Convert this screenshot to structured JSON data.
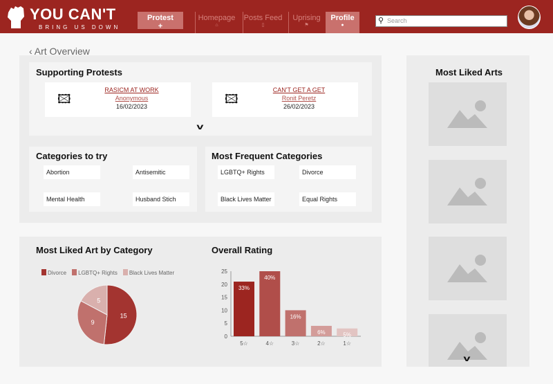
{
  "header": {
    "logo_title": "YOU CAN'T",
    "logo_subtitle": "BRING US DOWN",
    "protest_label": "Protest",
    "protest_icon": "+",
    "nav": [
      {
        "label": "Homepage",
        "icon": "home-icon"
      },
      {
        "label": "Posts Feed",
        "icon": "document-icon"
      },
      {
        "label": "Uprising",
        "icon": "flag-icon"
      },
      {
        "label": "Profile",
        "icon": "user-icon",
        "active": true
      }
    ],
    "search_placeholder": "Search"
  },
  "page": {
    "back_label": "Art Overview"
  },
  "supporting": {
    "title": "Supporting Protests",
    "items": [
      {
        "title": "RASICM AT WORK",
        "author": "Anonymous",
        "date": "16/02/2023"
      },
      {
        "title": "CAN'T GET A GET",
        "author": "Ronit Peretz",
        "date": "26/02/2023"
      }
    ]
  },
  "categories_try": {
    "title": "Categories to try",
    "items": [
      "Abortion",
      "Antisemitic",
      "Mental Health",
      "Husband Stich"
    ]
  },
  "frequent": {
    "title": "Most Frequent Categories",
    "items": [
      "LGBTQ+ Rights",
      "Divorce",
      "Black Lives Matter",
      "Equal Rights"
    ]
  },
  "most_liked_arts": {
    "title": "Most Liked Arts"
  },
  "chart_data": [
    {
      "type": "pie",
      "title": "Most Liked Art by Category",
      "categories": [
        "Divorce",
        "LGBTQ+ Rights",
        "Black Lives Matter"
      ],
      "values": [
        15,
        9,
        5
      ],
      "colors": [
        "#a33430",
        "#c0716d",
        "#d9b0ad"
      ],
      "legend": "top"
    },
    {
      "type": "bar",
      "title": "Overall Rating",
      "categories": [
        "5☆",
        "4☆",
        "3☆",
        "2☆",
        "1☆"
      ],
      "values": [
        21,
        25,
        10,
        4,
        3
      ],
      "labels": [
        "33%",
        "40%",
        "16%",
        "6%",
        "5%"
      ],
      "yticks": [
        "0",
        "5",
        "10",
        "15",
        "20",
        "25"
      ],
      "ylim": [
        0,
        25
      ],
      "colors": [
        "#9c2520",
        "#b04e4a",
        "#c0716d",
        "#d39c99",
        "#e2c4c2"
      ]
    }
  ]
}
